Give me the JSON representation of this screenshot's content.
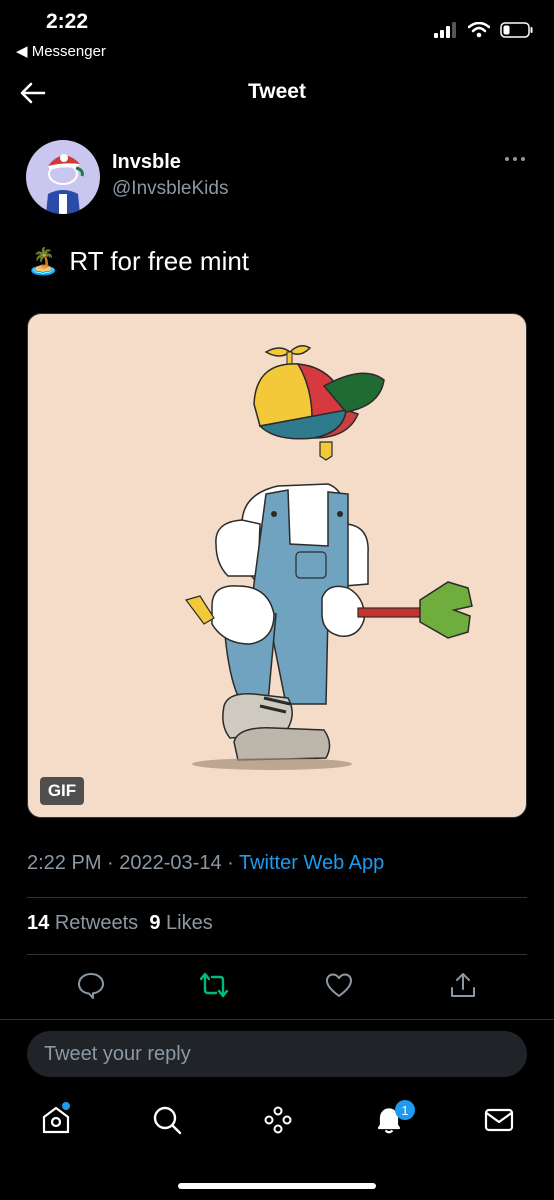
{
  "status_bar": {
    "time": "2:22",
    "back_app": "◀ Messenger"
  },
  "header": {
    "title": "Tweet"
  },
  "author": {
    "name": "Invsble",
    "handle": "@InvsbleKids"
  },
  "tweet": {
    "emoji": "🏝️",
    "text": "RT for free mint"
  },
  "media": {
    "badge": "GIF"
  },
  "meta": {
    "time": "2:22 PM",
    "sep1": " · ",
    "date": "2022-03-14",
    "sep2": " · ",
    "source": "Twitter Web App"
  },
  "stats": {
    "retweets_count": "14",
    "retweets_label": "Retweets",
    "likes_count": "9",
    "likes_label": "Likes"
  },
  "reply": {
    "placeholder": "Tweet your reply"
  },
  "nav": {
    "notifications_count": "1"
  },
  "colors": {
    "accent": "#1d9bf0",
    "retweet_green": "#00ba7c",
    "media_bg": "#f4dcc8"
  }
}
